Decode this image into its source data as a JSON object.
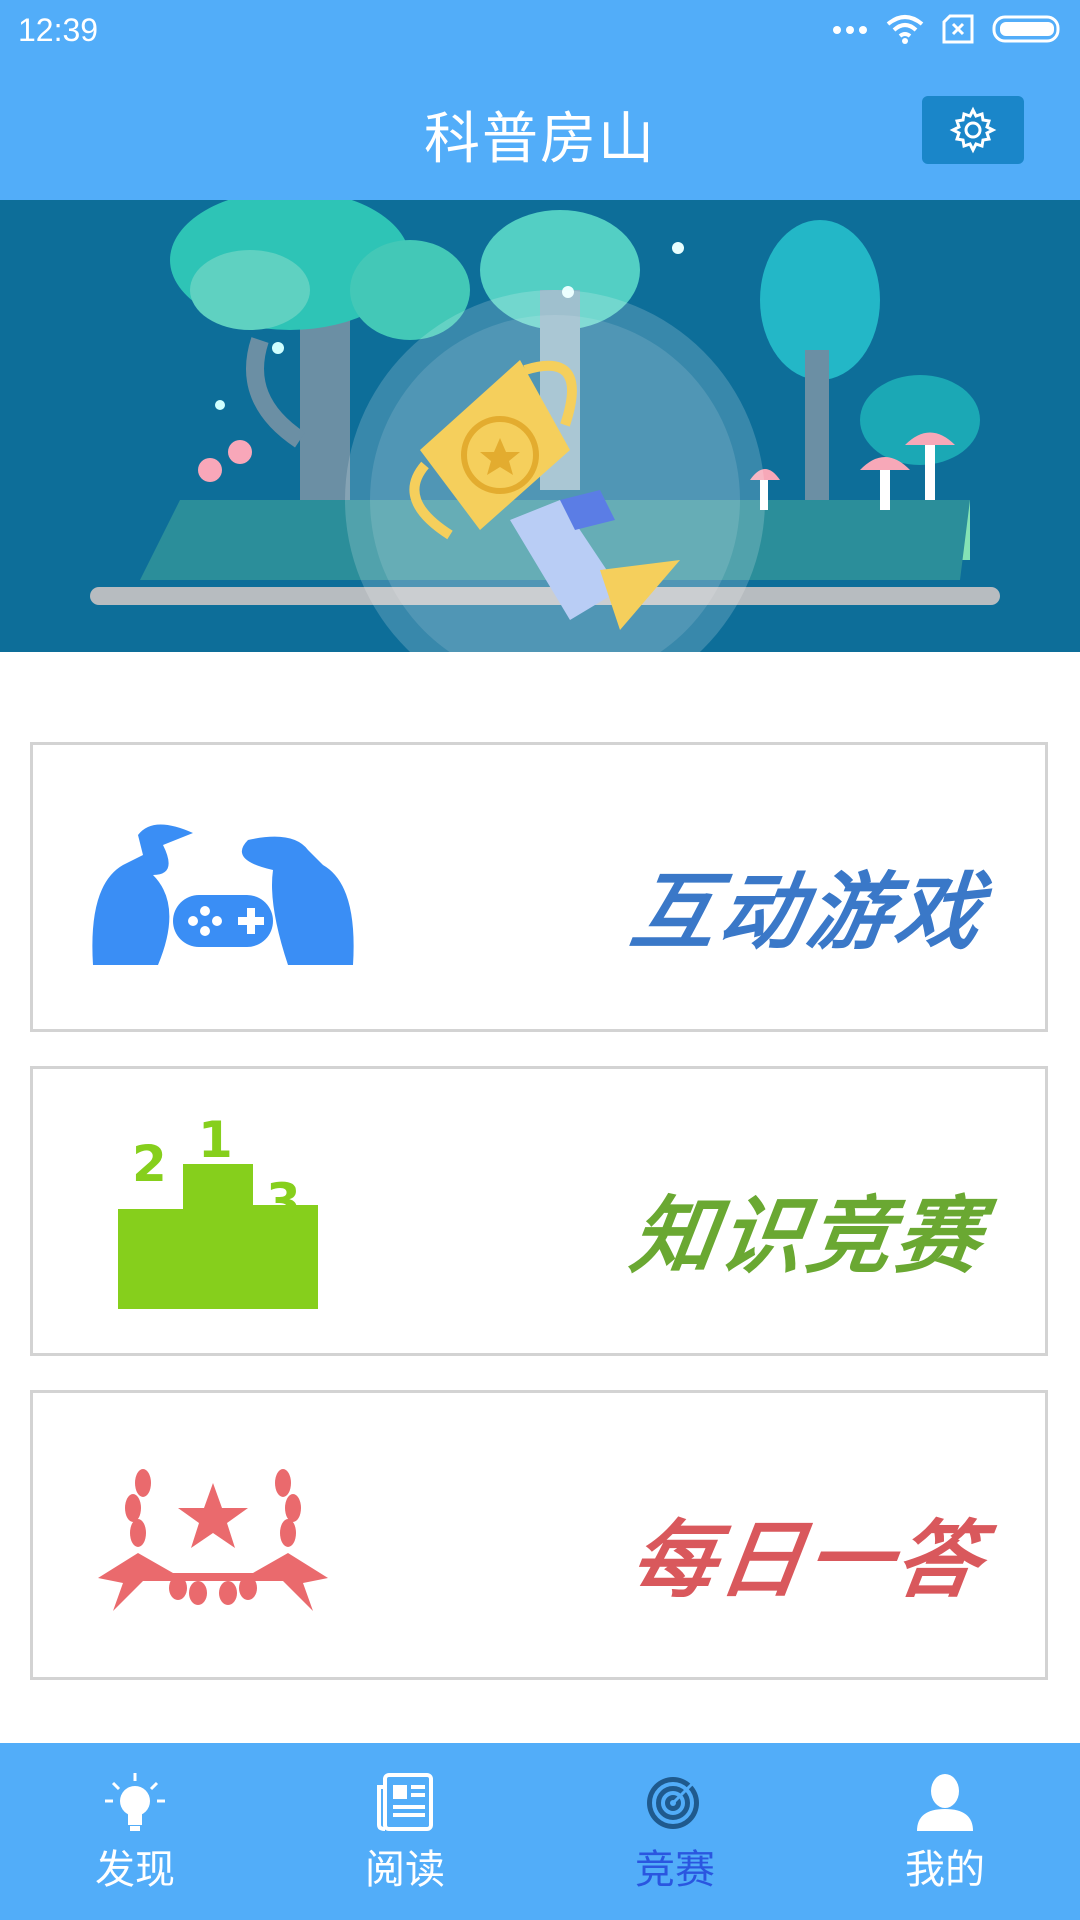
{
  "status_bar": {
    "time": "12:39",
    "icons": [
      "more-dots-icon",
      "wifi-icon",
      "sim-error-icon",
      "battery-icon"
    ]
  },
  "header": {
    "title": "科普房山",
    "settings_icon": "gear-icon"
  },
  "banner": {
    "description_icon": "trophy-icon"
  },
  "cards": [
    {
      "label": "互动游戏",
      "color": "#3a78c8",
      "icon": "gamepad-players-icon"
    },
    {
      "label": "知识竞赛",
      "color": "#6aa832",
      "icon": "podium-icon"
    },
    {
      "label": "每日一答",
      "color": "#d9585c",
      "icon": "laurel-star-icon"
    }
  ],
  "tabs": [
    {
      "label": "发现",
      "icon": "lightbulb-icon",
      "active": false
    },
    {
      "label": "阅读",
      "icon": "newspaper-icon",
      "active": false
    },
    {
      "label": "竞赛",
      "icon": "target-icon",
      "active": true
    },
    {
      "label": "我的",
      "icon": "user-icon",
      "active": false
    }
  ],
  "colors": {
    "primary": "#52adf9",
    "accent_dark": "#1a86c9",
    "active_tab": "#2a56e0"
  }
}
